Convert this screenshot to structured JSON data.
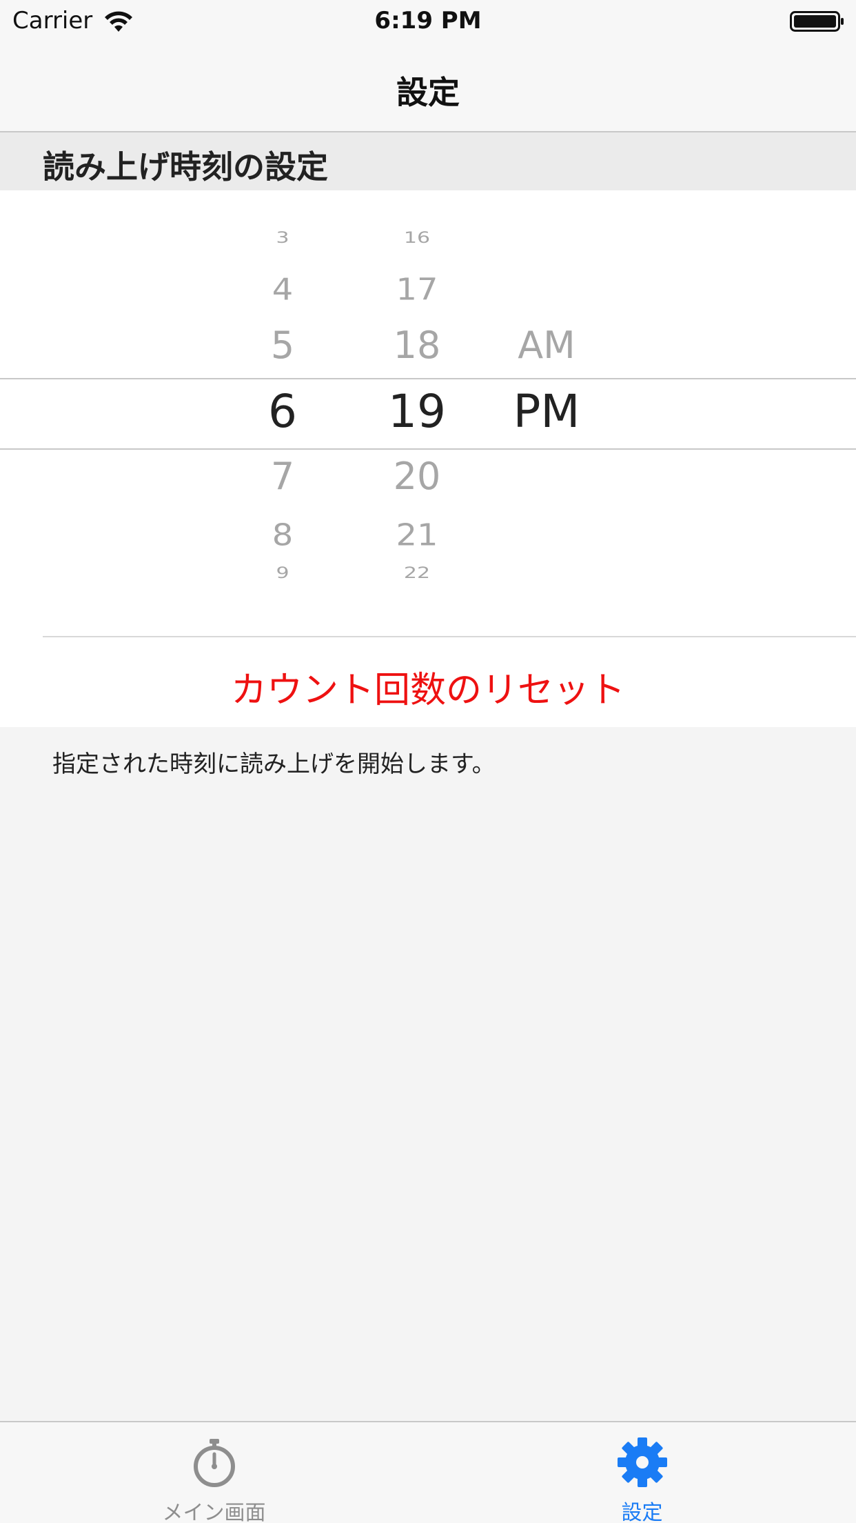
{
  "status_bar": {
    "carrier": "Carrier",
    "time": "6:19 PM"
  },
  "nav": {
    "title": "設定"
  },
  "section": {
    "title": "読み上げ時刻の設定"
  },
  "picker": {
    "hours": [
      "3",
      "4",
      "5",
      "6",
      "7",
      "8",
      "9"
    ],
    "minutes": [
      "16",
      "17",
      "18",
      "19",
      "20",
      "21",
      "22"
    ],
    "ampm_above": "AM",
    "selected_hour": "6",
    "selected_minute": "19",
    "selected_ampm": "PM"
  },
  "reset_button": {
    "label": "カウント回数のリセット",
    "color": "#ee1111"
  },
  "footer": {
    "note": "指定された時刻に読み上げを開始します。"
  },
  "tab_bar": {
    "tabs": [
      {
        "label": "メイン画面",
        "icon": "stopwatch-icon",
        "selected": false
      },
      {
        "label": "設定",
        "icon": "gear-icon",
        "selected": true
      }
    ],
    "selected_color": "#1a7cf5",
    "unselected_color": "#8e8e8e"
  }
}
